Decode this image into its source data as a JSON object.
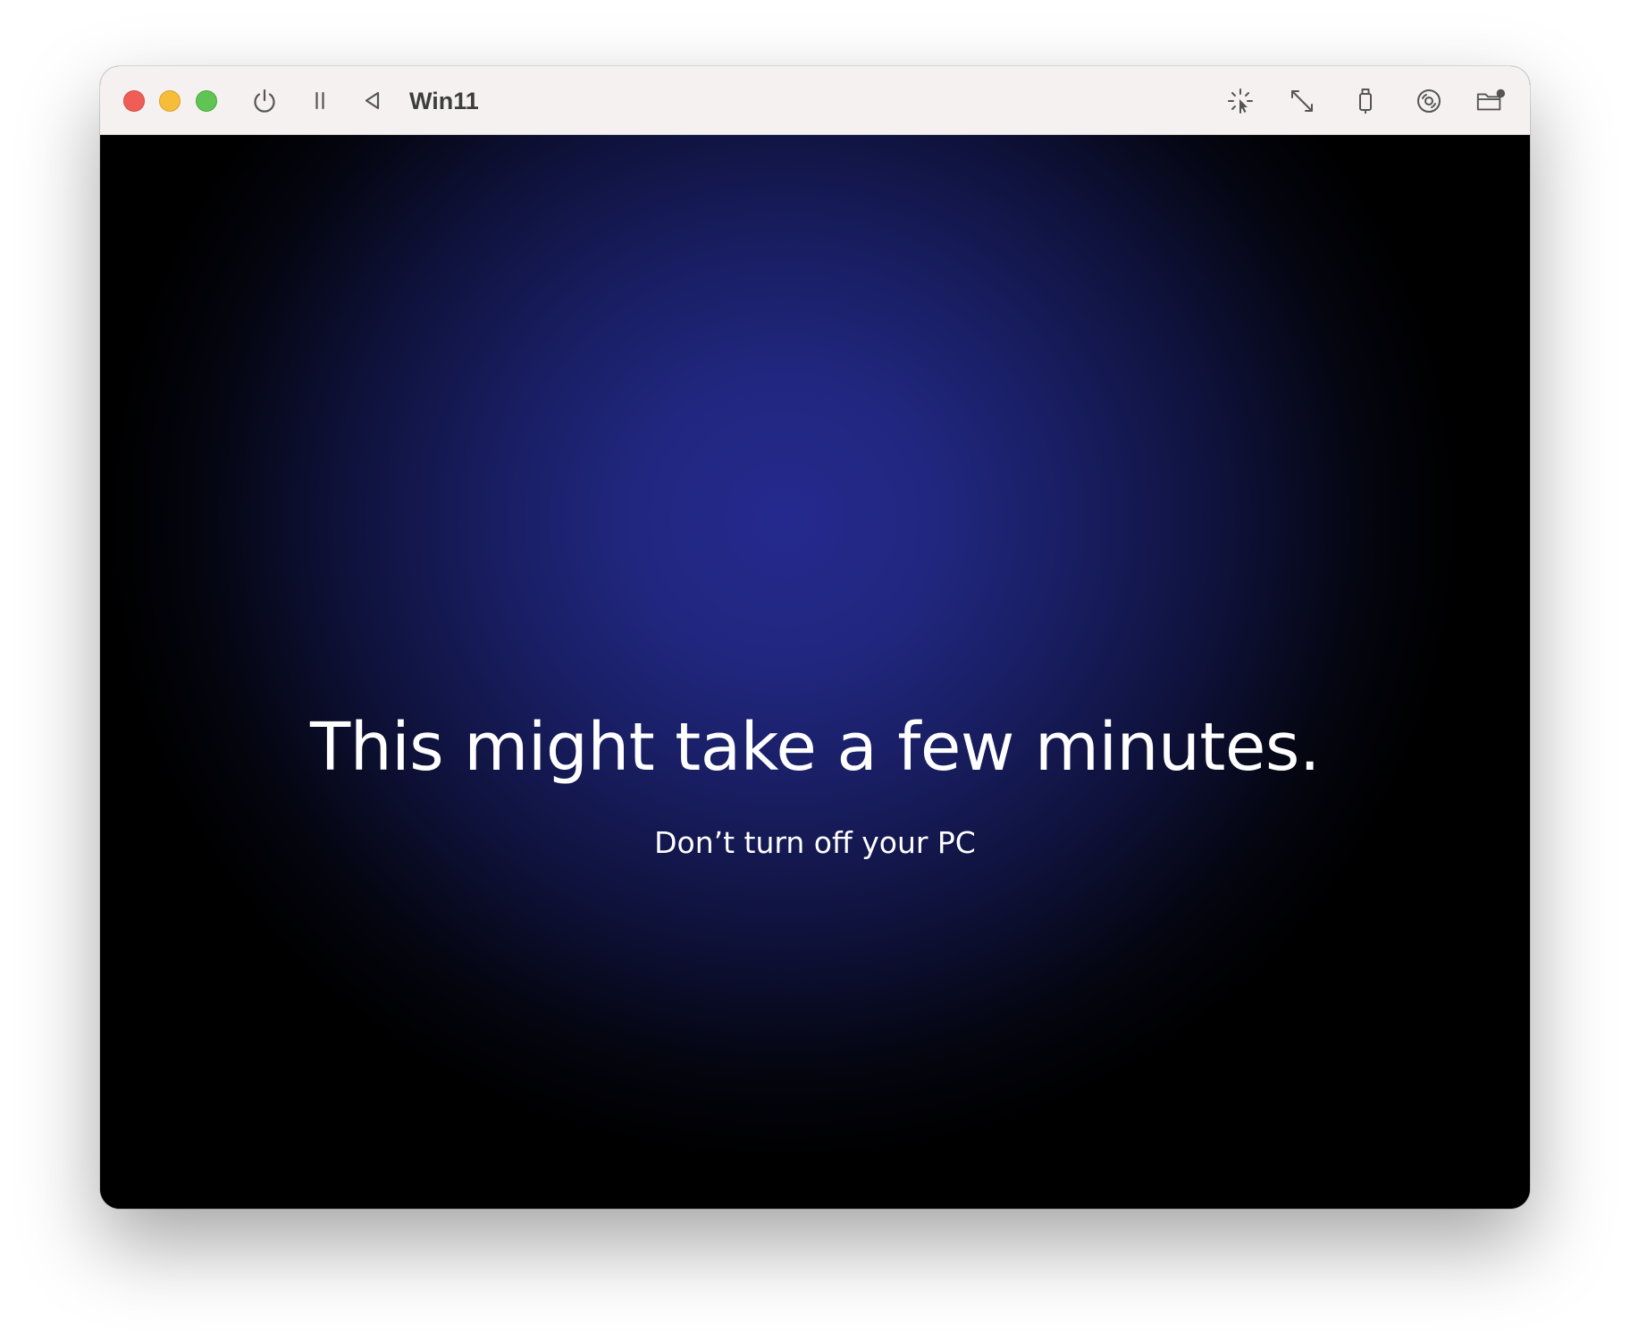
{
  "window": {
    "title": "Win11",
    "traffic_lights": {
      "close_color": "#ee5e57",
      "minimize_color": "#f5bd3a",
      "maximize_color": "#5fc454"
    },
    "toolbar_left_icons": [
      "power-icon",
      "pause-icon",
      "back-triangle-icon"
    ],
    "toolbar_right_icons": [
      "capture-pointer-icon",
      "resize-arrows-icon",
      "usb-device-icon",
      "disc-drive-icon",
      "shared-folder-icon"
    ]
  },
  "vm_screen": {
    "headline": "This might take a few minutes.",
    "subline": "Don’t turn off your PC",
    "background_center_color": "#25298e",
    "background_edge_color": "#000000",
    "text_color": "#ffffff"
  }
}
